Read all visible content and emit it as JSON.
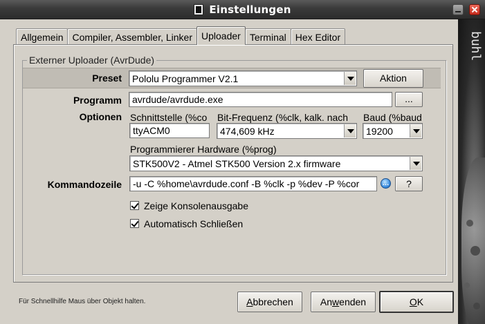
{
  "window": {
    "title": "Einstellungen"
  },
  "brand": "buhl",
  "tabs": [
    {
      "label": "Allgemein",
      "active": false
    },
    {
      "label": "Compiler, Assembler, Linker",
      "active": false
    },
    {
      "label": "Uploader",
      "active": true
    },
    {
      "label": "Terminal",
      "active": false
    },
    {
      "label": "Hex Editor",
      "active": false
    }
  ],
  "group": {
    "title": "Externer Uploader (AvrDude)"
  },
  "preset": {
    "label": "Preset",
    "value": "Pololu Programmer V2.1",
    "action_button": "Aktion"
  },
  "programm": {
    "label": "Programm",
    "value": "avrdude/avrdude.exe",
    "browse_button": "..."
  },
  "optionen": {
    "label": "Optionen",
    "schnittstelle_label": "Schnittstelle (%co",
    "schnittstelle_value": "ttyACM0",
    "bitfrequenz_label": "Bit-Frequenz (%clk, kalk. nach",
    "bitfrequenz_value": "474,609 kHz",
    "baud_label": "Baud (%baud",
    "baud_value": "19200",
    "hardware_label": "Programmierer Hardware (%prog)",
    "hardware_value": "STK500V2 - Atmel STK500 Version 2.x firmware"
  },
  "kommandozeile": {
    "label": "Kommandozeile",
    "value": "-u -C %home\\avrdude.conf -B %clk -p %dev -P %cor",
    "info_icon": "info-icon",
    "help_button": "?"
  },
  "checkboxes": [
    {
      "label": "Zeige Konsolenausgabe",
      "checked": true
    },
    {
      "label": "Automatisch Schließen",
      "checked": true
    }
  ],
  "footer": {
    "hint": "Für Schnellhilfe Maus über Objekt halten.",
    "cancel_button": {
      "pre": "",
      "mnemonic": "A",
      "post": "bbrechen"
    },
    "apply_button": {
      "pre": "An",
      "mnemonic": "w",
      "post": "enden"
    },
    "ok_button": {
      "pre": "",
      "mnemonic": "O",
      "post": "K"
    }
  }
}
